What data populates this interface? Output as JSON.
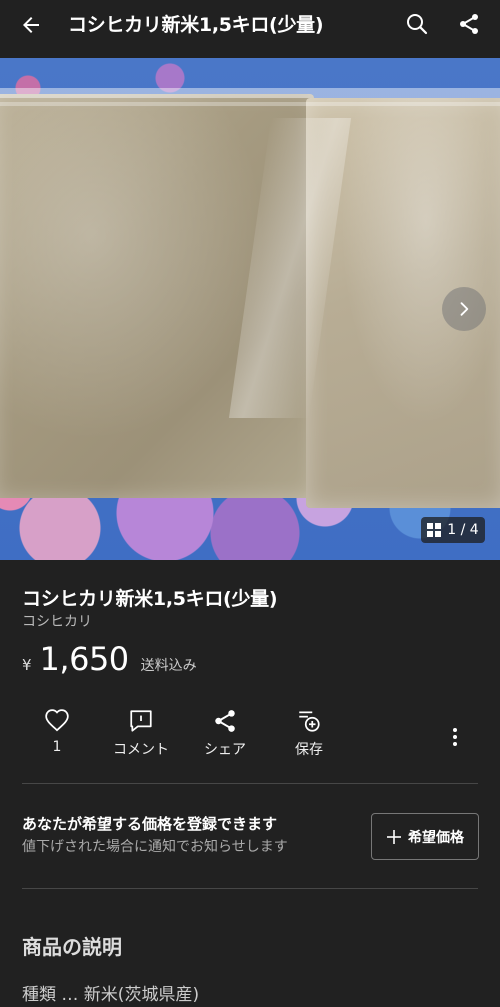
{
  "appbar": {
    "title": "コシヒカリ新米1,5キロ(少量)",
    "icons": [
      "arrow-left-icon",
      "search-icon",
      "share-icon"
    ]
  },
  "gallery": {
    "counter": "1 / 4",
    "icons": [
      "chevron-right-icon",
      "grid-icon"
    ]
  },
  "item": {
    "name": "コシヒカリ新米1,5キロ(少量)",
    "brand": "コシヒカリ",
    "currency": "¥",
    "price": "1,650",
    "shipping": "送料込み"
  },
  "actions": {
    "like_count": "1",
    "comment": "コメント",
    "share": "シェア",
    "save": "保存",
    "icons": [
      "heart-icon",
      "comment-icon",
      "share-icon",
      "save-list-icon",
      "more-vertical-icon"
    ]
  },
  "offer": {
    "title": "あなたが希望する価格を登録できます",
    "subtitle": "値下げされた場合に通知でお知らせします",
    "button": "希望価格"
  },
  "description": {
    "heading": "商品の説明",
    "first_line": "種類 … 新米(茨城県産)"
  },
  "colors": {
    "background": "#212121",
    "divider": "#474747",
    "text_secondary": "#aaaaaa"
  }
}
